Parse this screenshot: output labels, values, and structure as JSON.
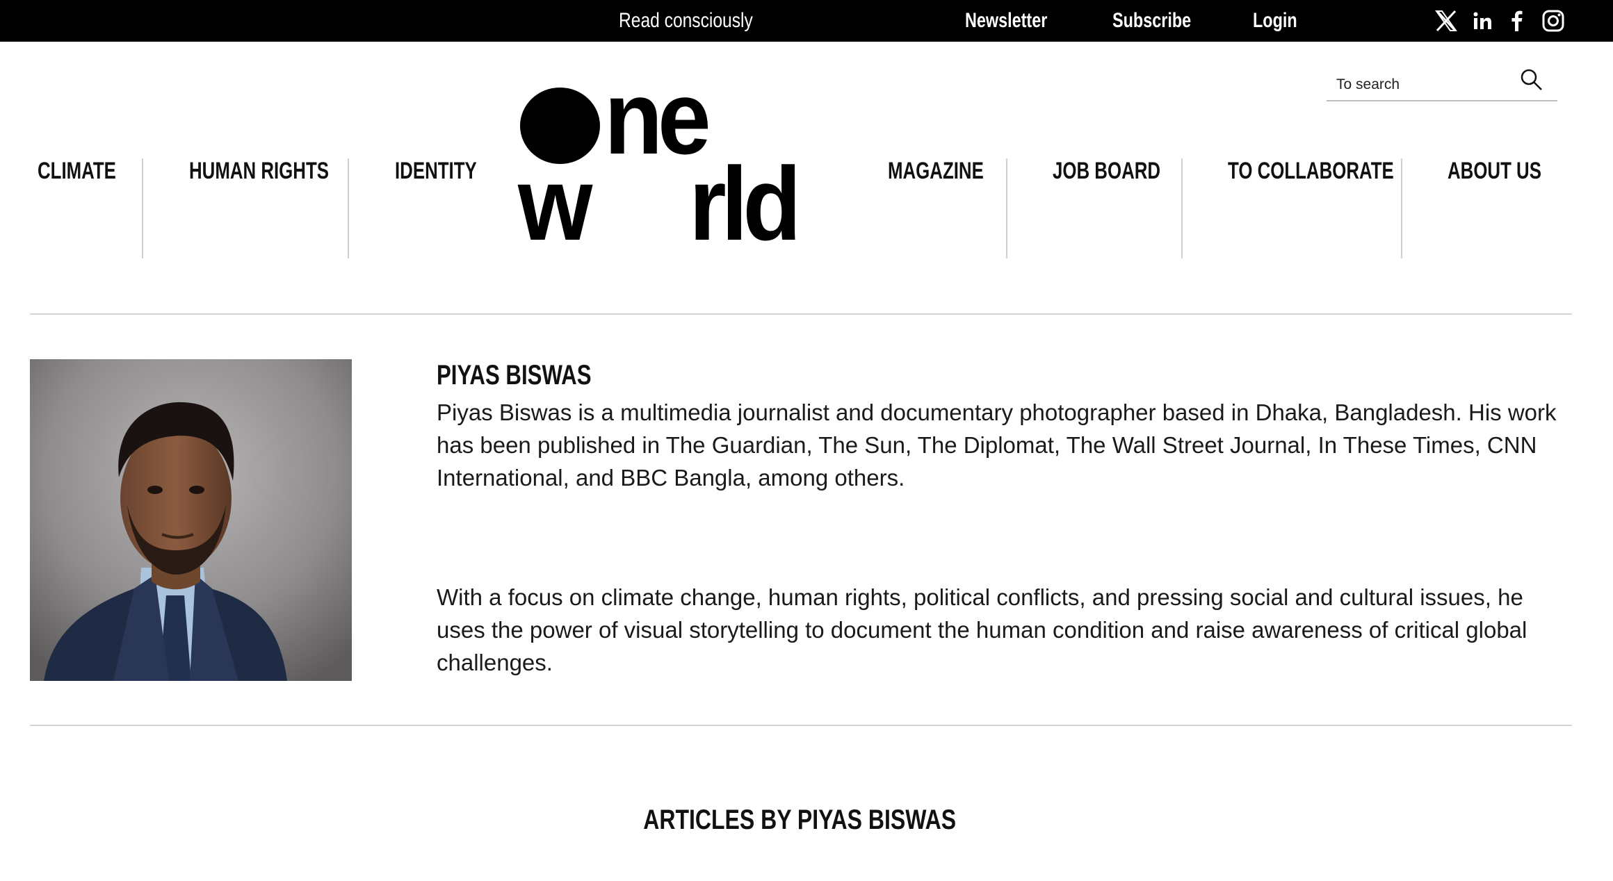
{
  "topbar": {
    "tagline": "Read consciously",
    "links": {
      "newsletter": "Newsletter",
      "subscribe": "Subscribe",
      "login": "Login"
    },
    "social_icons": [
      "x-icon",
      "linkedin-icon",
      "facebook-icon",
      "instagram-icon"
    ]
  },
  "search": {
    "placeholder": "To search"
  },
  "nav": {
    "left": [
      "CLIMATE",
      "HUMAN RIGHTS",
      "IDENTITY"
    ],
    "right": [
      "MAGAZINE",
      "JOB BOARD",
      "TO COLLABORATE",
      "ABOUT US"
    ]
  },
  "logo": {
    "top": "ne",
    "bottom_left": "w",
    "bottom_right": "rld"
  },
  "author": {
    "name": "PIYAS BISWAS",
    "bio_1": "Piyas Biswas is a multimedia journalist and documentary photographer based in Dhaka, Bangladesh. His work has been published in The Guardian, The Sun, The Diplomat, The Wall Street Journal, In These Times, CNN International, and BBC Bangla, among others.",
    "bio_2": "With a focus on climate change, human rights, political conflicts, and pressing social and cultural issues, he uses the power of visual storytelling to document the human condition and raise awareness of critical global challenges."
  },
  "articles_heading": "ARTICLES BY PIYAS BISWAS",
  "colors": {
    "topbar_bg": "#000000",
    "text": "#111111",
    "divider": "#d4d4d4"
  }
}
